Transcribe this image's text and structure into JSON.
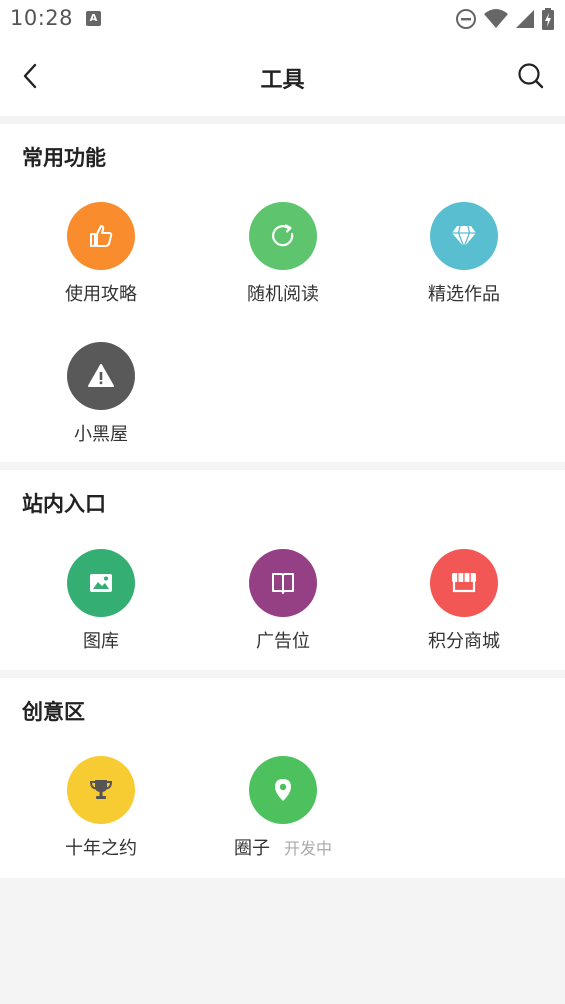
{
  "status_bar": {
    "time": "10:28",
    "notification_glyph": "A"
  },
  "header": {
    "title": "工具"
  },
  "sections": [
    {
      "title": "常用功能",
      "items": [
        {
          "label": "使用攻略",
          "icon": "thumbs-up-icon",
          "color": "#f98c2c"
        },
        {
          "label": "随机阅读",
          "icon": "refresh-icon",
          "color": "#5ec46e"
        },
        {
          "label": "精选作品",
          "icon": "diamond-icon",
          "color": "#58bed0"
        },
        {
          "label": "小黑屋",
          "icon": "warning-icon",
          "color": "#595959"
        }
      ]
    },
    {
      "title": "站内入口",
      "items": [
        {
          "label": "图库",
          "icon": "image-icon",
          "color": "#35ae74"
        },
        {
          "label": "广告位",
          "icon": "book-icon",
          "color": "#953f85"
        },
        {
          "label": "积分商城",
          "icon": "store-icon",
          "color": "#f25755"
        }
      ]
    },
    {
      "title": "创意区",
      "items": [
        {
          "label": "十年之约",
          "icon": "trophy-icon",
          "color": "#f7cc33"
        },
        {
          "label": "圈子",
          "sub": "开发中",
          "icon": "location-pin-icon",
          "color": "#4dc15e"
        }
      ]
    }
  ]
}
